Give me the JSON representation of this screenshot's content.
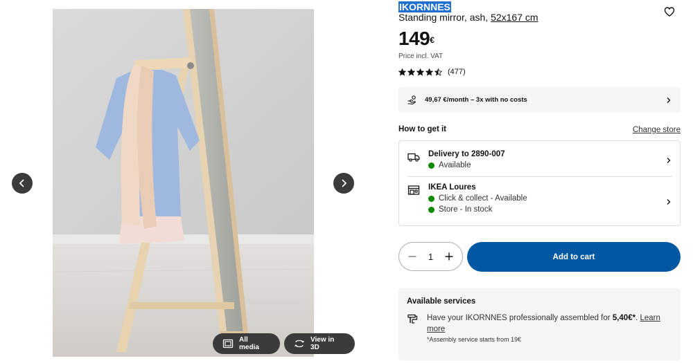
{
  "gallery": {
    "image_alt": "Standing mirror with scarf and shirt hanging on top",
    "prev_icon": "chevron-left-icon",
    "next_icon": "chevron-right-icon",
    "all_media_label": "All media",
    "view_3d_label": "View in 3D"
  },
  "product": {
    "name": "IKORNNES",
    "description": "Standing mirror, ash,",
    "size": "52x167 cm",
    "price": "149",
    "currency": "€",
    "price_note": "Price incl. VAT",
    "rating": 4.5,
    "review_count": "(477)"
  },
  "finance": {
    "text": "49,67 €/month – 3x with no costs"
  },
  "availability": {
    "title": "How to get it",
    "change_store_label": "Change store",
    "delivery": {
      "title": "Delivery to 2890-007",
      "status": "Available"
    },
    "store": {
      "title": "IKEA Loures",
      "click_collect": "Click & collect - Available",
      "in_store": "Store - In stock"
    }
  },
  "cart": {
    "quantity": "1",
    "add_label": "Add to cart"
  },
  "services": {
    "title": "Available services",
    "text_before": "Have your IKORNNES professionally assembled for ",
    "price": "5,40€*",
    "text_after": ". ",
    "learn_more": "Learn more",
    "note": "*Assembly service starts from 19€"
  },
  "colors": {
    "accent_blue": "#0058a3",
    "selection_blue": "#1f6fd1",
    "available_green": "#0a8a00",
    "panel_grey": "#f5f5f5"
  }
}
